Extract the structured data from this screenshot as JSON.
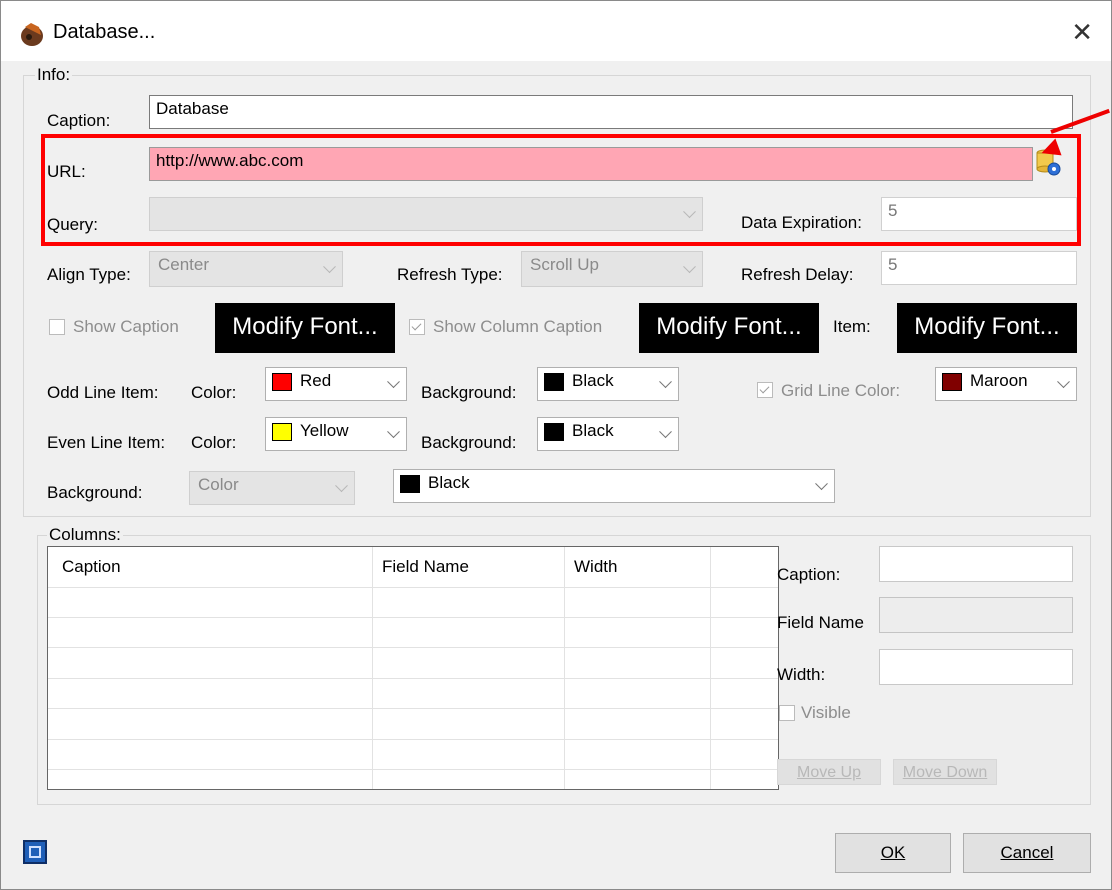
{
  "window": {
    "title": "Database..."
  },
  "info": {
    "group_label": "Info:",
    "caption_label": "Caption:",
    "caption_value": "Database",
    "url_label": "URL:",
    "url_value": "http://www.abc.com",
    "query_label": "Query:",
    "query_value": "",
    "data_expiration_label": "Data Expiration:",
    "data_expiration_value": "5",
    "align_type_label": "Align Type:",
    "align_type_value": "Center",
    "refresh_type_label": "Refresh Type:",
    "refresh_type_value": "Scroll Up",
    "refresh_delay_label": "Refresh Delay:",
    "refresh_delay_value": "5",
    "show_caption_label": "Show Caption",
    "modify_font_label": "Modify Font...",
    "show_column_caption_label": "Show Column Caption",
    "item_label": "Item:",
    "odd_line_label": "Odd Line Item:",
    "even_line_label": "Even Line Item:",
    "color_label": "Color:",
    "background_label": "Background:",
    "odd_color": {
      "name": "Red",
      "hex": "#ff0000"
    },
    "odd_background": {
      "name": "Black",
      "hex": "#000000"
    },
    "even_color": {
      "name": "Yellow",
      "hex": "#ffff00"
    },
    "even_background": {
      "name": "Black",
      "hex": "#000000"
    },
    "grid_line_color_label": "Grid Line Color:",
    "grid_line_color": {
      "name": "Maroon",
      "hex": "#800000"
    },
    "bg_type_value": "Color",
    "bg_color": {
      "name": "Black",
      "hex": "#000000"
    }
  },
  "columns": {
    "group_label": "Columns:",
    "headers": [
      "Caption",
      "Field Name",
      "Width"
    ],
    "caption_label": "Caption:",
    "field_name_label": "Field Name",
    "width_label": "Width:",
    "visible_label": "Visible",
    "move_up_label": "Move Up",
    "move_down_label": "Move Down"
  },
  "footer": {
    "ok_label": "OK",
    "cancel_label": "Cancel"
  },
  "annotation": {
    "highlight_color": "#ff0000",
    "url_field_color": "#ffa6b4"
  }
}
